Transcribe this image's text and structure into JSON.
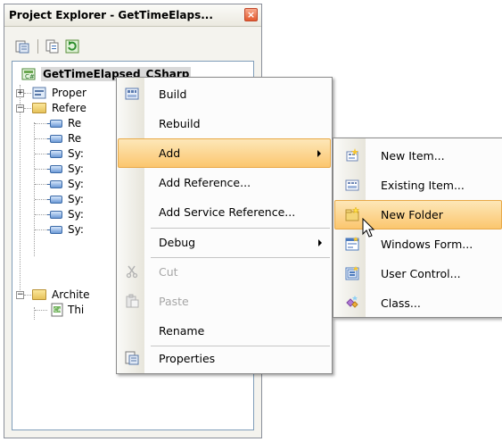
{
  "panel": {
    "title": "Project Explorer - GetTimeElaps...",
    "close_glyph": "×"
  },
  "toolbar": {
    "buttons": [
      {
        "name": "properties-tool-icon"
      },
      {
        "name": "show-all-files-icon"
      },
      {
        "name": "refresh-icon"
      }
    ]
  },
  "tree": {
    "project": "GetTimeElapsed_CSharp",
    "items": [
      {
        "label": "Proper",
        "icon": "properties-icon"
      },
      {
        "label": "Refere",
        "icon": "folder-icon"
      },
      {
        "label": "Re",
        "icon": "reference-icon"
      },
      {
        "label": "Re",
        "icon": "reference-icon"
      },
      {
        "label": "Sy:",
        "icon": "reference-icon"
      },
      {
        "label": "Sy:",
        "icon": "reference-icon"
      },
      {
        "label": "Sy:",
        "icon": "reference-icon"
      },
      {
        "label": "Sy:",
        "icon": "reference-icon"
      },
      {
        "label": "Sy:",
        "icon": "reference-icon"
      },
      {
        "label": "Sy:",
        "icon": "reference-icon"
      },
      {
        "label": "Archite",
        "icon": "folder-icon"
      },
      {
        "label": "Thi",
        "icon": "csharp-file-icon"
      }
    ]
  },
  "context_menu": {
    "items": [
      {
        "label": "Build",
        "icon": "build-icon",
        "disabled": false
      },
      {
        "label": "Rebuild",
        "disabled": false
      },
      {
        "label": "Add",
        "submenu": true,
        "highlighted": true
      },
      {
        "label": "Add Reference...",
        "disabled": false
      },
      {
        "label": "Add Service Reference...",
        "disabled": false
      },
      {
        "label": "Debug",
        "submenu": true
      },
      {
        "label": "Cut",
        "icon": "cut-icon",
        "disabled": true
      },
      {
        "label": "Paste",
        "icon": "paste-icon",
        "disabled": true
      },
      {
        "label": "Rename",
        "disabled": false
      },
      {
        "label": "Properties",
        "icon": "properties-icon",
        "disabled": false
      }
    ]
  },
  "submenu": {
    "items": [
      {
        "label": "New Item...",
        "icon": "new-item-icon"
      },
      {
        "label": "Existing Item...",
        "icon": "existing-item-icon"
      },
      {
        "label": "New Folder",
        "icon": "new-folder-icon",
        "highlighted": true
      },
      {
        "label": "Windows Form...",
        "icon": "windows-form-icon"
      },
      {
        "label": "User Control...",
        "icon": "user-control-icon"
      },
      {
        "label": "Class...",
        "icon": "class-icon"
      }
    ]
  },
  "colors": {
    "highlight_top": "#fde7b8",
    "highlight_bottom": "#fbc66e",
    "close_button": "#e35a2e"
  }
}
